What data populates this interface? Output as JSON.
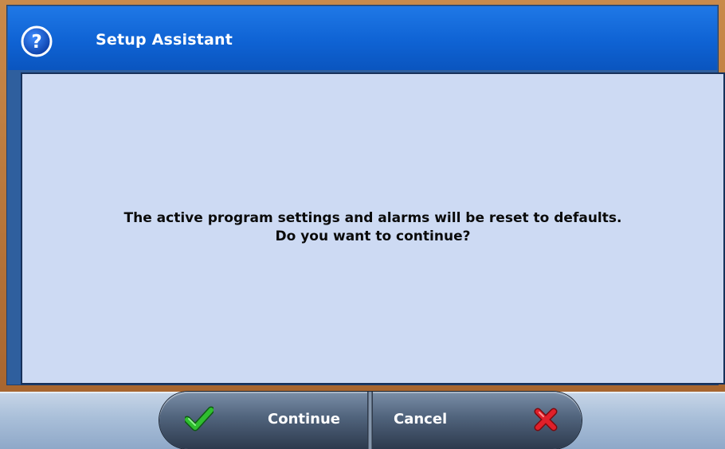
{
  "dialog": {
    "title": "Setup Assistant",
    "title_icon": "help-question-icon",
    "message_line1": "The active program settings and alarms will be reset to defaults.",
    "message_line2": "Do you want to continue?"
  },
  "buttons": {
    "continue_label": "Continue",
    "continue_icon": "check-icon",
    "cancel_label": "Cancel",
    "cancel_icon": "x-icon"
  },
  "colors": {
    "title_bar": "#0f63d4",
    "content_bg": "#cddaf3",
    "check_green": "#2fbf2f",
    "cancel_red": "#e0202a"
  }
}
